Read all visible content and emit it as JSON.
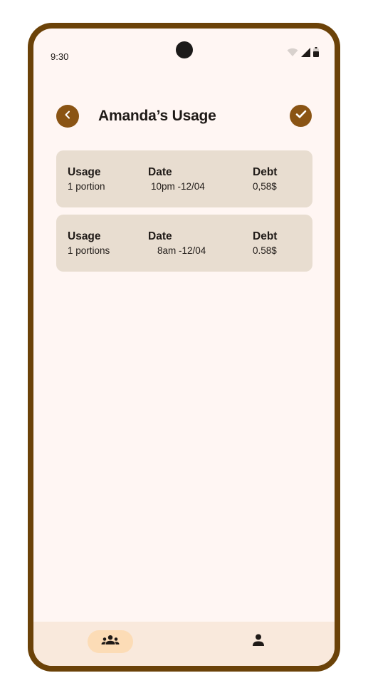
{
  "status_bar": {
    "time": "9:30",
    "icons": [
      "wifi-icon",
      "signal-icon",
      "battery-icon"
    ]
  },
  "header": {
    "title": "Amanda’s Usage",
    "back_icon": "chevron-left-icon",
    "confirm_icon": "check-icon"
  },
  "usage_records": [
    {
      "usage_label": "Usage",
      "usage_value": "1 portion",
      "date_label": "Date",
      "date_value": "10pm -12/04",
      "debt_label": "Debt",
      "debt_value": "0,58$"
    },
    {
      "usage_label": "Usage",
      "usage_value": "1 portions",
      "date_label": "Date",
      "date_value": "8am -12/04",
      "debt_label": "Debt",
      "debt_value": "0.58$"
    }
  ],
  "bottom_nav": {
    "items": [
      {
        "icon": "groups-icon",
        "active": true
      },
      {
        "icon": "person-icon",
        "active": false
      }
    ]
  },
  "colors": {
    "accent": "#8a5414",
    "frame": "#6b4208",
    "background": "#fff6f3",
    "card": "#e8ddd0",
    "nav_background": "#f9e9dc",
    "nav_active": "#fcdcb6"
  }
}
